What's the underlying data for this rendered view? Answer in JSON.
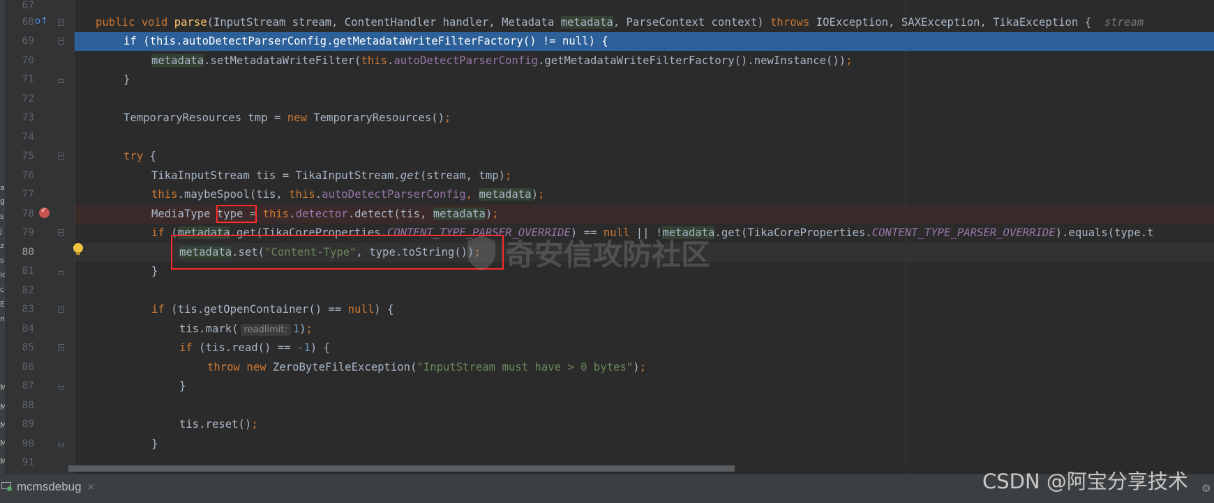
{
  "gutter": {
    "lines": [
      "67",
      "68",
      "69",
      "70",
      "71",
      "72",
      "73",
      "74",
      "75",
      "76",
      "77",
      "78",
      "79",
      "80",
      "81",
      "82",
      "83",
      "84",
      "85",
      "86",
      "87",
      "88",
      "89",
      "90",
      "91"
    ]
  },
  "code": {
    "line67": "",
    "line68": {
      "public": "public",
      "void": "void",
      "parse": "parse",
      "open": "(InputStream stream, ContentHandler handler, Metadata ",
      "metadata": "metadata",
      "rest": ", ParseContext context) ",
      "throws": "throws",
      "exceptions": " IOException, SAXException, TikaException {",
      "hint": "stream"
    },
    "line69": {
      "if": "if",
      "open": " (",
      "this": "this",
      "dot": ".",
      "field": "autoDetectParserConfig",
      "call": ".getMetadataWriteFilterFactory() != ",
      "null": "null",
      "close": ") {"
    },
    "line70": {
      "metadata": "metadata",
      "call": ".setMetadataWriteFilter(",
      "this": "this",
      "dot": ".",
      "field": "autoDetectParserConfig",
      "rest": ".getMetadataWriteFilterFactory().newInstance())",
      "semi": ";"
    },
    "line71": "}",
    "line73": {
      "decl": "TemporaryResources tmp = ",
      "new": "new",
      "rest": " TemporaryResources()",
      "semi": ";"
    },
    "line75": {
      "try": "try",
      "rest": " {"
    },
    "line76": {
      "decl": "TikaInputStream tis = TikaInputStream.",
      "get": "get",
      "args": "(stream, tmp)",
      "semi": ";"
    },
    "line77": {
      "this1": "this",
      "call": ".maybeSpool(tis, ",
      "this2": "this",
      "dot": ".",
      "field": "autoDetectParserConfig",
      "comma": ", ",
      "metadata": "metadata",
      "close": ")",
      "semi": ";"
    },
    "line78": {
      "type": "MediaType ",
      "var": "type",
      "eq": " = ",
      "this": "this",
      "dot": ".",
      "field": "detector",
      "call": ".detect(tis, ",
      "metadata": "metadata",
      "close": ")",
      "semi": ";"
    },
    "line79": {
      "if": "if",
      "open": " (",
      "metadata1": "metadata",
      "get1": ".get(TikaCoreProperties.",
      "const1": "CONTENT_TYPE_PARSER_OVERRIDE",
      "eq": ") == ",
      "null": "null",
      "or": " || !",
      "metadata2": "metadata",
      "get2": ".get(TikaCoreProperties.",
      "const2": "CONTENT_TYPE_PARSER_OVERRIDE",
      "rest": ").equals(type.t"
    },
    "line80": {
      "metadata": "metadata",
      "call": ".set(",
      "str": "\"Content-Type\"",
      "rest": ", type.toString())",
      "semi": ";"
    },
    "line81": "}",
    "line83": {
      "if": "if",
      "rest": " (tis.getOpenContainer() == ",
      "null": "null",
      "close": ") {"
    },
    "line84": {
      "call": "tis.mark(",
      "hint": "readlimit:",
      "num": "1",
      "close": ")",
      "semi": ";"
    },
    "line85": {
      "if": "if",
      "rest": " (tis.read() == ",
      "num": "-1",
      "close": ") {"
    },
    "line86": {
      "throw": "throw",
      "new": "new",
      "cls": " ZeroByteFileException(",
      "str": "\"InputStream must have > 0 bytes\"",
      "close": ")",
      "semi": ";"
    },
    "line87": "}",
    "line89": {
      "call": "tis.reset()",
      "semi": ";"
    },
    "line90": "}"
  },
  "left_strip_chars": [
    "a",
    "gi",
    "s",
    "j",
    "z",
    "s",
    "ic",
    "c",
    "E",
    "n",
    "M",
    "M",
    "M",
    "M",
    "M"
  ],
  "bottom_bar": {
    "tab_label": "mcmsdebug",
    "close_symbol": "×"
  },
  "watermark": {
    "text": "CSDN @阿宝分享技术",
    "overlay_text": "奇安信攻防社区"
  },
  "colors": {
    "editor_bg": "#2b2b2b",
    "exec_line": "#2d5f99",
    "breakpoint": "#c75450",
    "annotation_box": "#ff2a2a",
    "keyword": "#cc7832",
    "field": "#9876aa",
    "string": "#6a8759"
  }
}
